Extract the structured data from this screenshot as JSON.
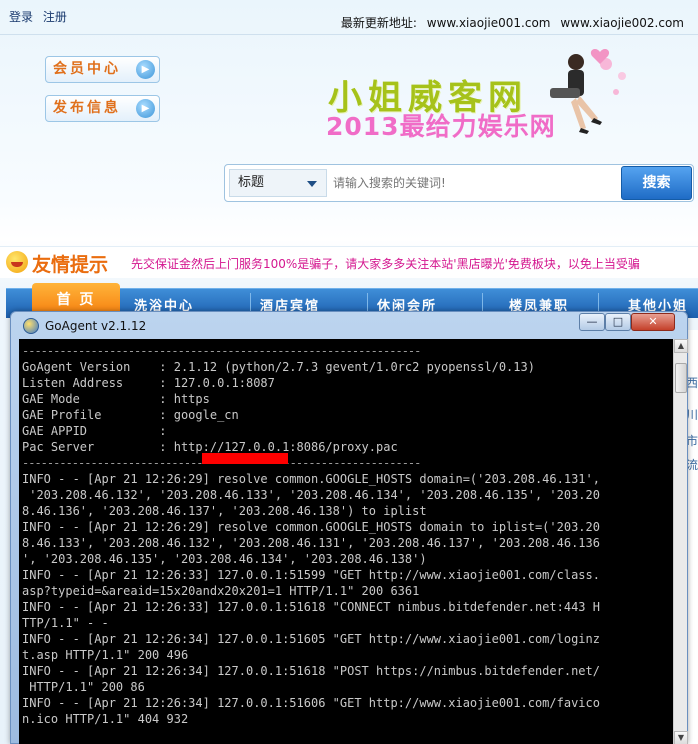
{
  "site": {
    "top_links": [
      "登录",
      "注册"
    ],
    "latest_label": "最新更新地址:",
    "latest_urls": [
      "www.xiaojie001.com",
      "www.xiaojie002.com"
    ],
    "side_buttons": [
      "会员中心",
      "发布信息"
    ],
    "logo_title": "小姐威客网",
    "logo_subtitle": "2013最给力娱乐网",
    "search": {
      "select_value": "标题",
      "placeholder": "请输入搜索的关键词!",
      "button": "搜索"
    },
    "notice": {
      "title": "友情提示",
      "text": "先交保证金然后上门服务100%是骗子，请大家多多关注本站'黑店曝光'免费板块，以免上当受骗"
    },
    "nav": [
      "首 页",
      "洗浴中心",
      "酒店宾馆",
      "休闲会所",
      "楼凤兼职",
      "其他小姐"
    ],
    "right_strip": [
      "西",
      "川",
      "市",
      "流"
    ],
    "colors": {
      "nav_blue": "#1c5fae",
      "home_orange": "#f57a0a",
      "notice_pink": "#d4168f",
      "logo_green": "#a6c21a",
      "logo_pink": "#f06cc7"
    }
  },
  "window": {
    "title": "GoAgent v2.1.12",
    "icon": "goagent-app-icon",
    "controls": {
      "minimize": "—",
      "maximize": "□",
      "close": "✕"
    },
    "console_lines": [
      "----------------------------------------------------------------",
      "GoAgent Version    : 2.1.12 (python/2.7.3 gevent/1.0rc2 pyopenssl/0.13)",
      "Listen Address     : 127.0.0.1:8087",
      "GAE Mode           : https",
      "GAE Profile        : google_cn",
      "GAE APPID          :",
      "Pac Server         : http://127.0.0.1:8086/proxy.pac",
      "----------------------------------------------------------------",
      "INFO - - [Apr 21 12:26:29] resolve common.GOOGLE_HOSTS domain=('203.208.46.131',",
      " '203.208.46.132', '203.208.46.133', '203.208.46.134', '203.208.46.135', '203.20",
      "8.46.136', '203.208.46.137', '203.208.46.138') to iplist",
      "INFO - - [Apr 21 12:26:29] resolve common.GOOGLE_HOSTS domain to iplist=('203.20",
      "8.46.133', '203.208.46.132', '203.208.46.131', '203.208.46.137', '203.208.46.136",
      "', '203.208.46.135', '203.208.46.134', '203.208.46.138')",
      "INFO - - [Apr 21 12:26:33] 127.0.0.1:51599 \"GET http://www.xiaojie001.com/class.",
      "asp?typeid=&areaid=15x20andx20x201=1 HTTP/1.1\" 200 6361",
      "INFO - - [Apr 21 12:26:33] 127.0.0.1:51618 \"CONNECT nimbus.bitdefender.net:443 H",
      "TTP/1.1\" - -",
      "INFO - - [Apr 21 12:26:34] 127.0.0.1:51605 \"GET http://www.xiaojie001.com/loginz",
      "t.asp HTTP/1.1\" 200 496",
      "INFO - - [Apr 21 12:26:34] 127.0.0.1:51618 \"POST https://nimbus.bitdefender.net/",
      " HTTP/1.1\" 200 86",
      "INFO - - [Apr 21 12:26:34] 127.0.0.1:51606 \"GET http://www.xiaojie001.com/favico",
      "n.ico HTTP/1.1\" 404 932"
    ],
    "scrollbar": {
      "up": "▲",
      "down": "▼"
    }
  }
}
